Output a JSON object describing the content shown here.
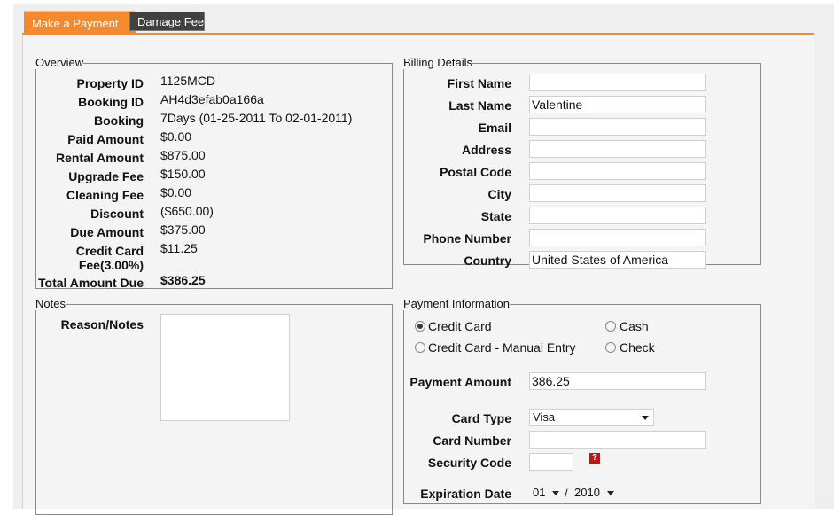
{
  "tabs": [
    "Make a Payment",
    "Damage Fee"
  ],
  "overview": {
    "legend": "Overview",
    "rows": [
      {
        "label": "Property ID",
        "value": "1125MCD"
      },
      {
        "label": "Booking ID",
        "value": "AH4d3efab0a166a"
      },
      {
        "label": "Booking",
        "value": "7Days (01-25-2011 To  02-01-2011)"
      },
      {
        "label": "Paid Amount",
        "value": "$0.00"
      },
      {
        "label": "Rental Amount",
        "value": "$875.00"
      },
      {
        "label": "Upgrade Fee",
        "value": "$150.00"
      },
      {
        "label": "Cleaning Fee",
        "value": "$0.00"
      },
      {
        "label": "Discount",
        "value": "($650.00)"
      },
      {
        "label": "Due Amount",
        "value": "$375.00"
      },
      {
        "label": "Credit Card",
        "label2": "Fee(3.00%)",
        "value": "$11.25"
      },
      {
        "label": "Total Amount Due",
        "value": "$386.25"
      }
    ]
  },
  "notes": {
    "legend": "Notes",
    "label": "Reason/Notes",
    "value": ""
  },
  "billing": {
    "legend": "Billing Details",
    "fields": [
      {
        "label": "First Name",
        "value": ""
      },
      {
        "label": "Last Name",
        "value": "Valentine"
      },
      {
        "label": "Email",
        "value": ""
      },
      {
        "label": "Address",
        "value": ""
      },
      {
        "label": "Postal Code",
        "value": ""
      },
      {
        "label": "City",
        "value": ""
      },
      {
        "label": "State",
        "value": ""
      },
      {
        "label": "Phone Number",
        "value": ""
      },
      {
        "label": "Country",
        "value": "United States of America"
      }
    ]
  },
  "payment": {
    "legend": "Payment Information",
    "methods": [
      {
        "label": "Credit Card",
        "selected": true
      },
      {
        "label": "Credit Card - Manual Entry",
        "selected": false
      },
      {
        "label": "Cash",
        "selected": false
      },
      {
        "label": "Check",
        "selected": false
      }
    ],
    "amount_label": "Payment Amount",
    "amount_value": "386.25",
    "card_type_label": "Card Type",
    "card_type_value": "Visa",
    "card_number_label": "Card Number",
    "card_number_value": "",
    "security_code_label": "Security Code",
    "security_code_value": "",
    "help_icon": "?",
    "expiration_label": "Expiration Date",
    "expiration_month": "01",
    "expiration_separator": "/",
    "expiration_year": "2010"
  },
  "colors": {
    "accent": "#f48a2e",
    "tab_inactive": "#414141",
    "help_icon": "#b31a14"
  }
}
